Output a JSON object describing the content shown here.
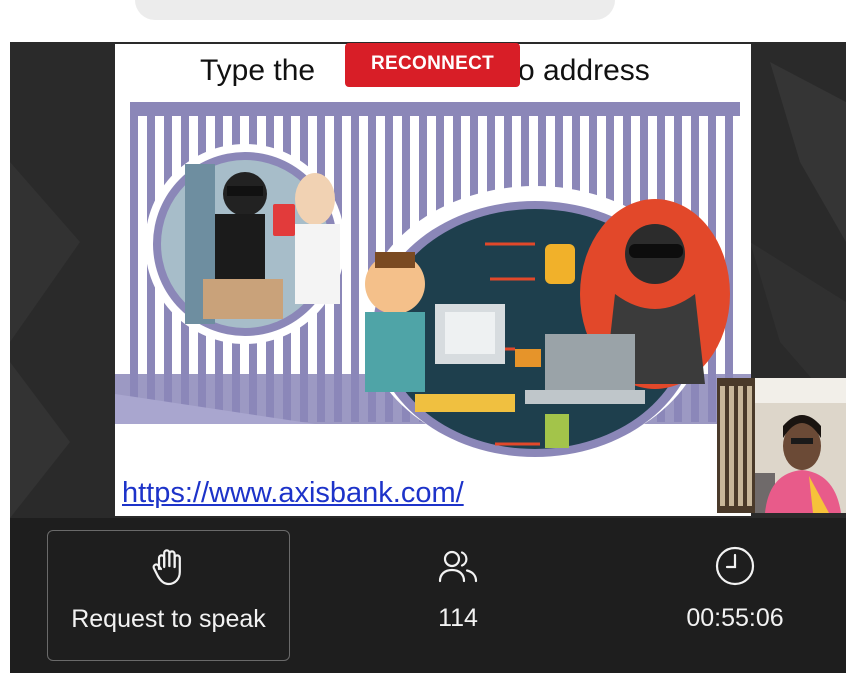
{
  "slide": {
    "title_left": "Type the",
    "title_right": "o address",
    "url": "https://www.axisbank.com/"
  },
  "reconnect_button": {
    "label": "RECONNECT"
  },
  "controls": {
    "request_to_speak": {
      "label": "Request to speak",
      "icon": "raised-hand-icon"
    },
    "participants": {
      "count": "114",
      "icon": "participants-icon"
    },
    "timer": {
      "elapsed": "00:55:06",
      "icon": "clock-icon"
    }
  },
  "colors": {
    "reconnect": "#d81e27",
    "control_bar": "#1e1e1e",
    "link": "#1d33c9",
    "slide_stripe": "#8b87b8"
  }
}
